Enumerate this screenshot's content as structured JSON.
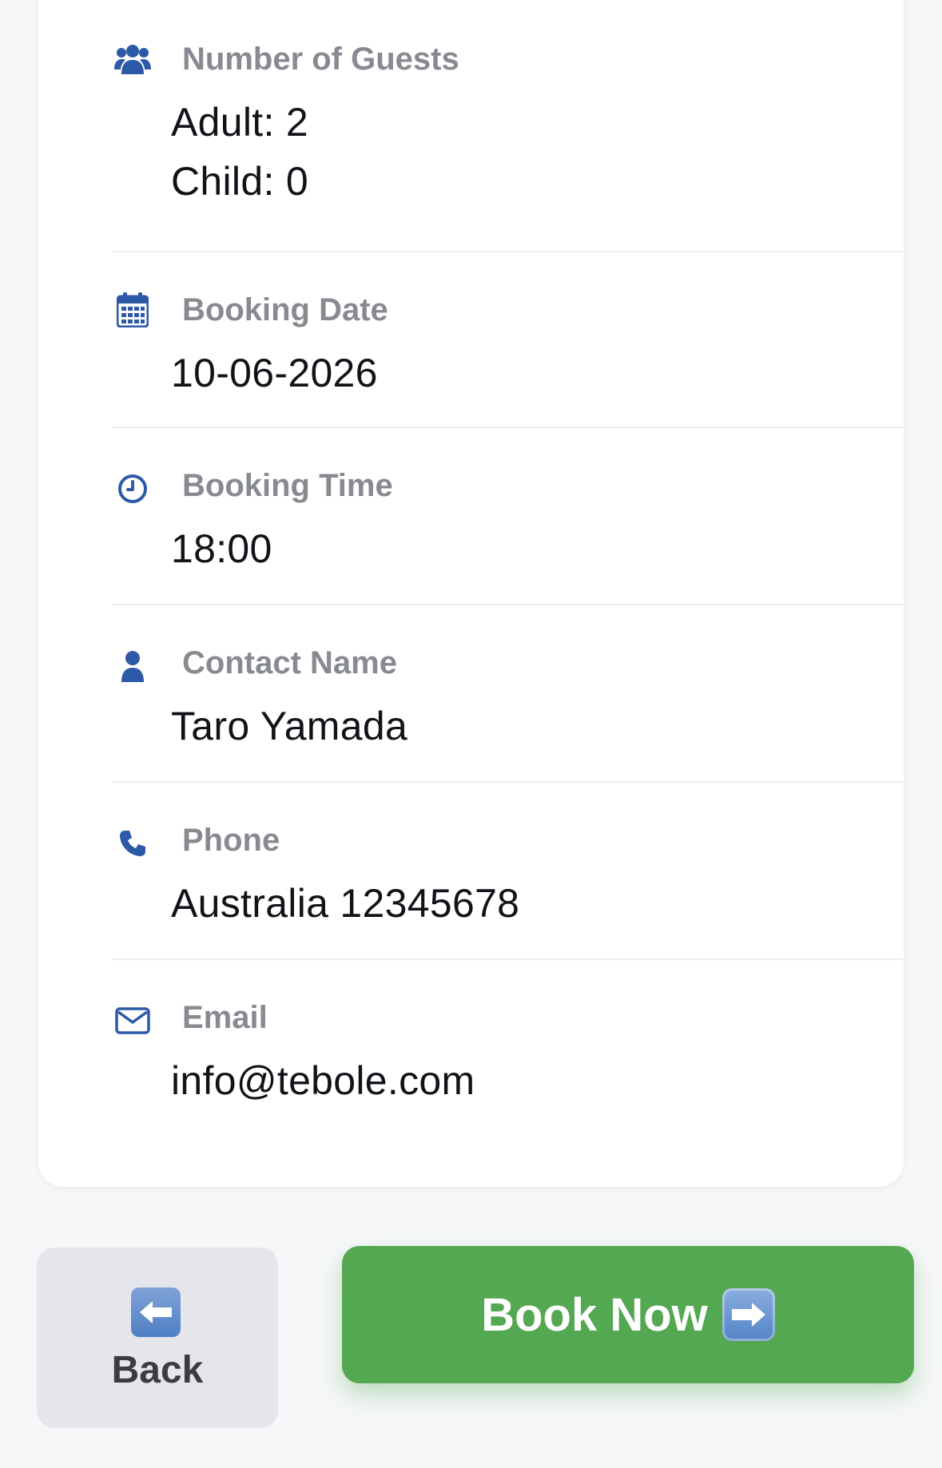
{
  "booking": {
    "guests": {
      "label": "Number of Guests",
      "adult": "Adult: 2",
      "child": "Child: 0",
      "icon": "users-icon"
    },
    "date": {
      "label": "Booking Date",
      "value": "10-06-2026",
      "icon": "calendar-icon"
    },
    "time": {
      "label": "Booking Time",
      "value": "18:00",
      "icon": "clock-icon"
    },
    "contact": {
      "label": "Contact Name",
      "value": "Taro Yamada",
      "icon": "user-icon"
    },
    "phone": {
      "label": "Phone",
      "value": "Australia 12345678",
      "icon": "phone-icon"
    },
    "email": {
      "label": "Email",
      "value": "info@tebole.com",
      "icon": "envelope-icon"
    }
  },
  "actions": {
    "back_label": "Back",
    "back_icon": "left-arrow-emoji-icon",
    "book_label": "Book Now",
    "book_icon": "right-arrow-emoji-icon"
  },
  "colors": {
    "icon_blue": "#2d5aa7",
    "label_gray": "#878a90",
    "book_green": "#54a851",
    "back_gray": "#e5e6eb"
  }
}
